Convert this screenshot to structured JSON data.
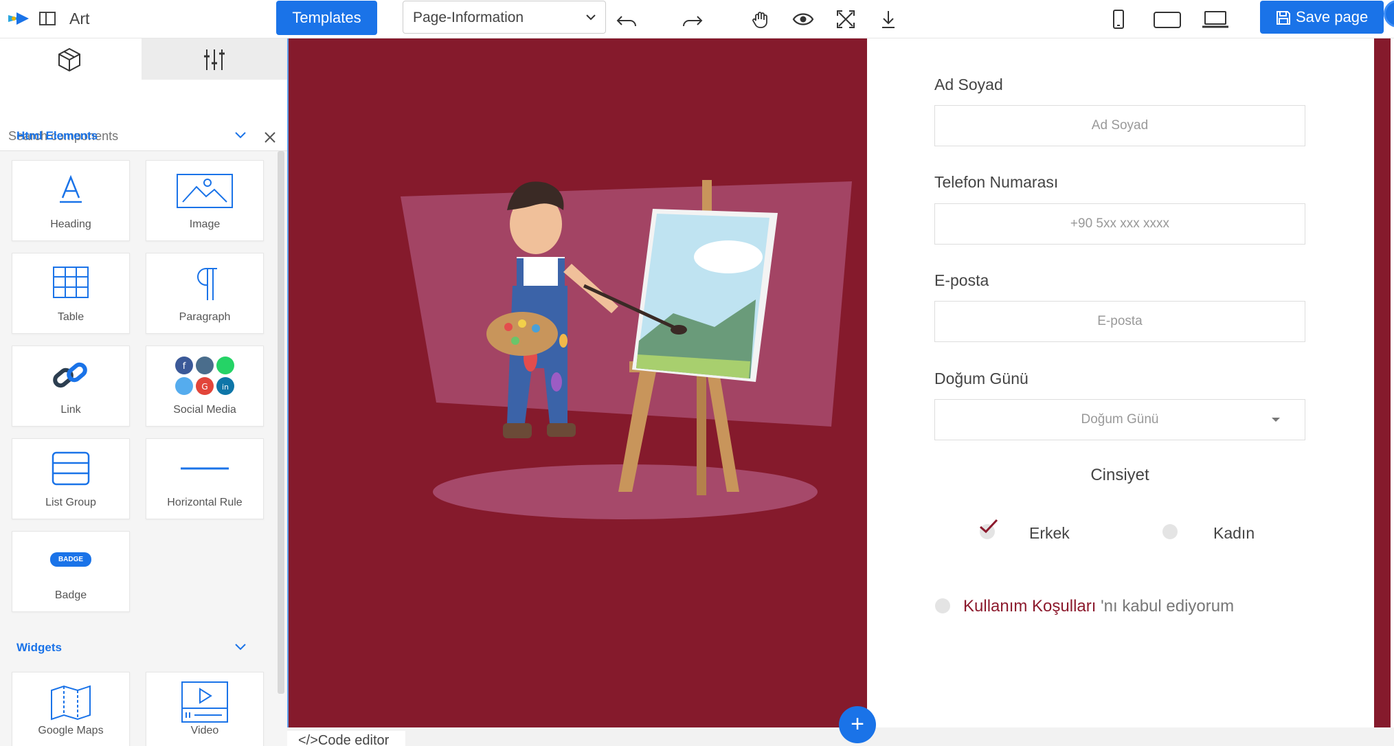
{
  "app": {
    "title": "Art"
  },
  "toolbar": {
    "templates_label": "Templates",
    "page_selected": "Page-Information",
    "save_label": "Save page",
    "icons": [
      "undo-icon",
      "redo-icon",
      "hand-icon",
      "eye-icon",
      "fullscreen-icon",
      "download-icon",
      "mobile-icon",
      "tablet-icon",
      "desktop-icon"
    ]
  },
  "sidebar": {
    "search_placeholder": "Search components",
    "sections": [
      {
        "label": "Html Elements"
      },
      {
        "label": "Widgets"
      }
    ],
    "html_elements": [
      {
        "label": "Heading",
        "icon": "heading-icon"
      },
      {
        "label": "Image",
        "icon": "image-icon"
      },
      {
        "label": "Table",
        "icon": "table-icon"
      },
      {
        "label": "Paragraph",
        "icon": "paragraph-icon"
      },
      {
        "label": "Link",
        "icon": "link-icon"
      },
      {
        "label": "Social Media",
        "icon": "social-media-icon"
      },
      {
        "label": "List Group",
        "icon": "list-group-icon"
      },
      {
        "label": "Horizontal Rule",
        "icon": "horizontal-rule-icon"
      },
      {
        "label": "Badge",
        "icon": "badge-icon",
        "badge_text": "BADGE"
      }
    ],
    "widgets": [
      {
        "label": "Google Maps",
        "icon": "map-icon"
      },
      {
        "label": "Video",
        "icon": "video-icon"
      }
    ]
  },
  "form": {
    "fields": [
      {
        "label": "Ad Soyad",
        "placeholder": "Ad Soyad"
      },
      {
        "label": "Telefon Numarası",
        "placeholder": "+90 5xx xxx xxxx"
      },
      {
        "label": "E-posta",
        "placeholder": "E-posta"
      },
      {
        "label": "Doğum Günü",
        "placeholder": "Doğum Günü"
      }
    ],
    "gender_title": "Cinsiyet",
    "gender_options": [
      "Erkek",
      "Kadın"
    ],
    "gender_selected": "Erkek",
    "terms_link": "Kullanım Koşulları",
    "terms_rest": " 'nı kabul ediyorum"
  },
  "bottom": {
    "code_editor_label": "</>Code editor",
    "add_label": "+"
  },
  "colors": {
    "accent": "#1a73e8",
    "brand": "#8c1a2d",
    "art_bg": "#851a2c"
  }
}
